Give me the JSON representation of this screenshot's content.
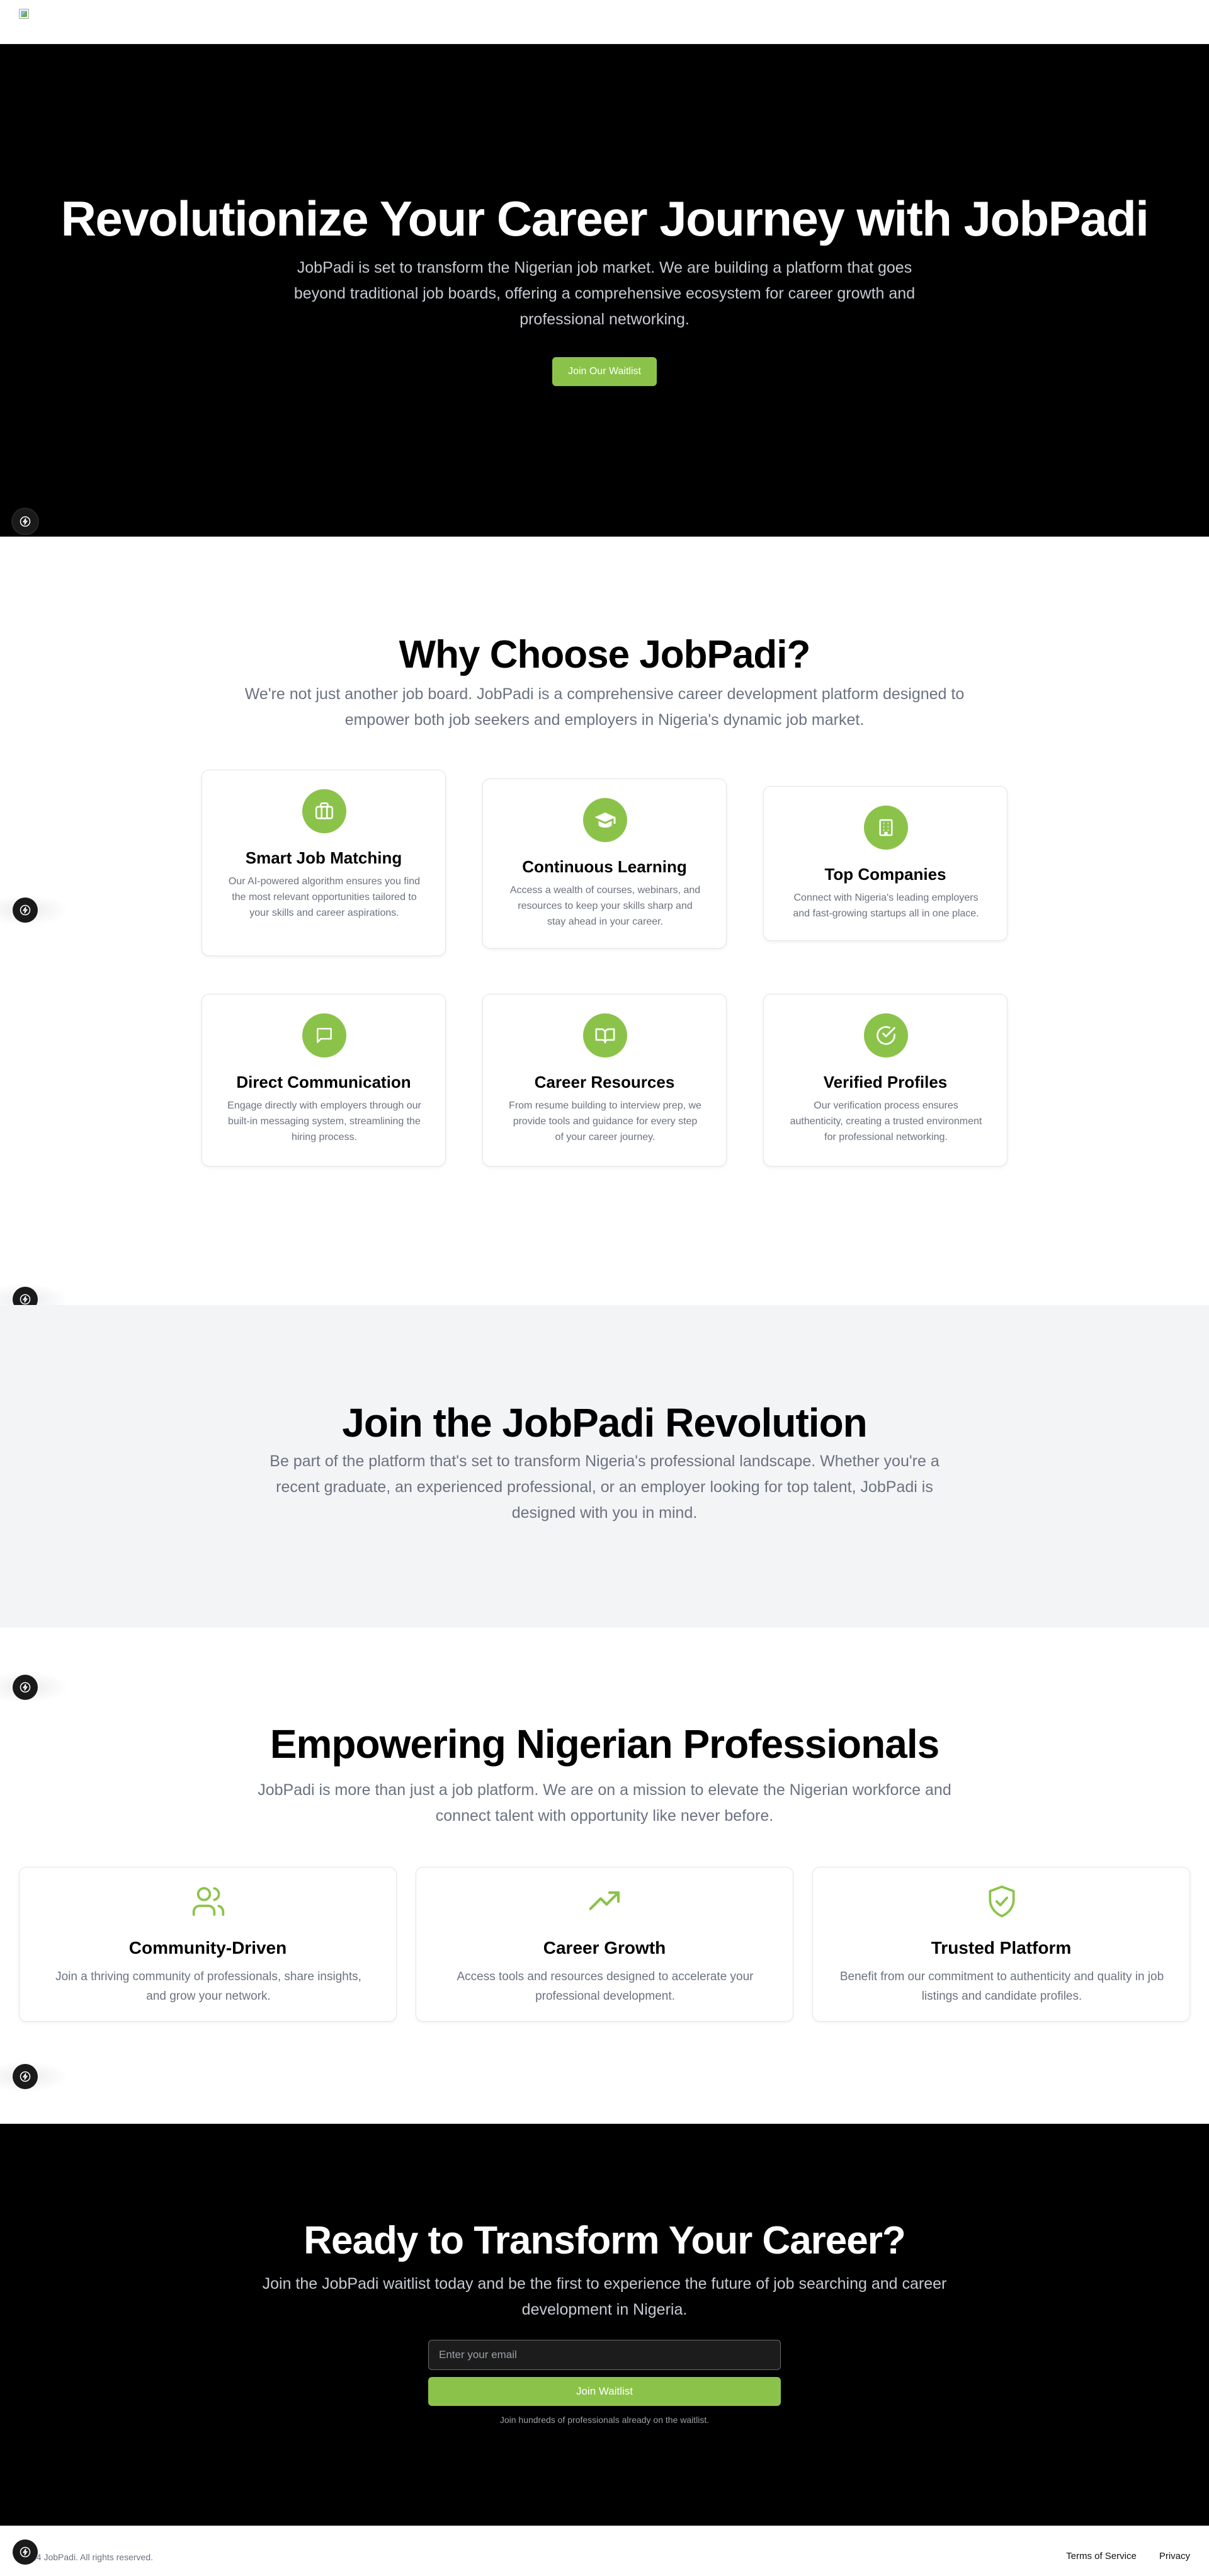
{
  "hero": {
    "title": "Revolutionize Your Career Journey with JobPadi",
    "subtitle": "JobPadi is set to transform the Nigerian job market. We are building a platform that goes beyond traditional job boards, offering a comprehensive ecosystem for career growth and professional networking.",
    "cta_label": "Join Our Waitlist"
  },
  "why": {
    "title": "Why Choose JobPadi?",
    "subtitle": "We're not just another job board. JobPadi is a comprehensive career development platform designed to empower both job seekers and employers in Nigeria's dynamic job market.",
    "features": [
      {
        "title": "Smart Job Matching",
        "description": "Our AI-powered algorithm ensures you find the most relevant opportunities tailored to your skills and career aspirations.",
        "icon": "briefcase-icon"
      },
      {
        "title": "Continuous Learning",
        "description": "Access a wealth of courses, webinars, and resources to keep your skills sharp and stay ahead in your career.",
        "icon": "graduation-cap-icon"
      },
      {
        "title": "Top Companies",
        "description": "Connect with Nigeria's leading employers and fast-growing startups all in one place.",
        "icon": "building-icon"
      },
      {
        "title": "Direct Communication",
        "description": "Engage directly with employers through our built-in messaging system, streamlining the hiring process.",
        "icon": "message-icon"
      },
      {
        "title": "Career Resources",
        "description": "From resume building to interview prep, we provide tools and guidance for every step of your career journey.",
        "icon": "book-icon"
      },
      {
        "title": "Verified Profiles",
        "description": "Our verification process ensures authenticity, creating a trusted environment for professional networking.",
        "icon": "check-circle-icon"
      }
    ]
  },
  "join": {
    "title": "Join the JobPadi Revolution",
    "subtitle": "Be part of the platform that's set to transform Nigeria's professional landscape. Whether you're a recent graduate, an experienced professional, or an employer looking for top talent, JobPadi is designed with you in mind."
  },
  "empower": {
    "title": "Empowering Nigerian Professionals",
    "subtitle": "JobPadi is more than just a job platform. We are on a mission to elevate the Nigerian workforce and connect talent with opportunity like never before.",
    "cards": [
      {
        "title": "Community-Driven",
        "description": "Join a thriving community of professionals, share insights, and grow your network.",
        "icon": "users-icon"
      },
      {
        "title": "Career Growth",
        "description": "Access tools and resources designed to accelerate your professional development.",
        "icon": "trending-up-icon"
      },
      {
        "title": "Trusted Platform",
        "description": "Benefit from our commitment to authenticity and quality in job listings and candidate profiles.",
        "icon": "shield-check-icon"
      }
    ]
  },
  "cta": {
    "title": "Ready to Transform Your Career?",
    "subtitle": "Join the JobPadi waitlist today and be the first to experience the future of job searching and career development in Nigeria.",
    "email_placeholder": "Enter your email",
    "button_label": "Join Waitlist",
    "note": "Join hundreds of professionals already on the waitlist."
  },
  "footer": {
    "copyright": "24 JobPadi. All rights reserved.",
    "links": [
      "Terms of Service",
      "Privacy"
    ]
  },
  "colors": {
    "accent": "#8bc34a",
    "hero_bg": "#000000",
    "muted_text": "#6b7280",
    "section_alt_bg": "#f3f4f6"
  }
}
